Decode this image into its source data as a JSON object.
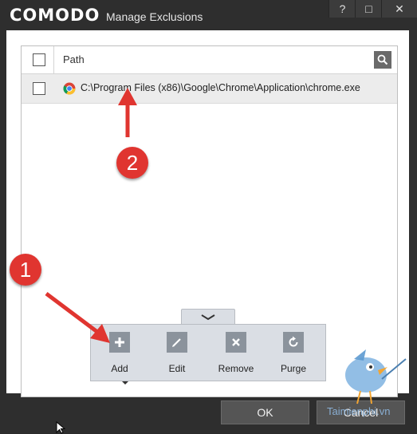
{
  "window": {
    "brand": "COMODO",
    "title": "Manage Exclusions",
    "controls": [
      "?",
      "□",
      "✕"
    ]
  },
  "grid": {
    "header": {
      "column": "Path"
    },
    "rows": [
      {
        "path": "C:\\Program Files (x86)\\Google\\Chrome\\Application\\chrome.exe",
        "icon": "chrome-icon"
      }
    ]
  },
  "toolbar": {
    "add": "Add",
    "edit": "Edit",
    "remove": "Remove",
    "purge": "Purge"
  },
  "buttons": {
    "ok": "OK",
    "cancel": "Cancel"
  },
  "annotations": {
    "marker1": "1",
    "marker2": "2",
    "color": "#e03530"
  },
  "watermark": "Taimienphi.vn"
}
